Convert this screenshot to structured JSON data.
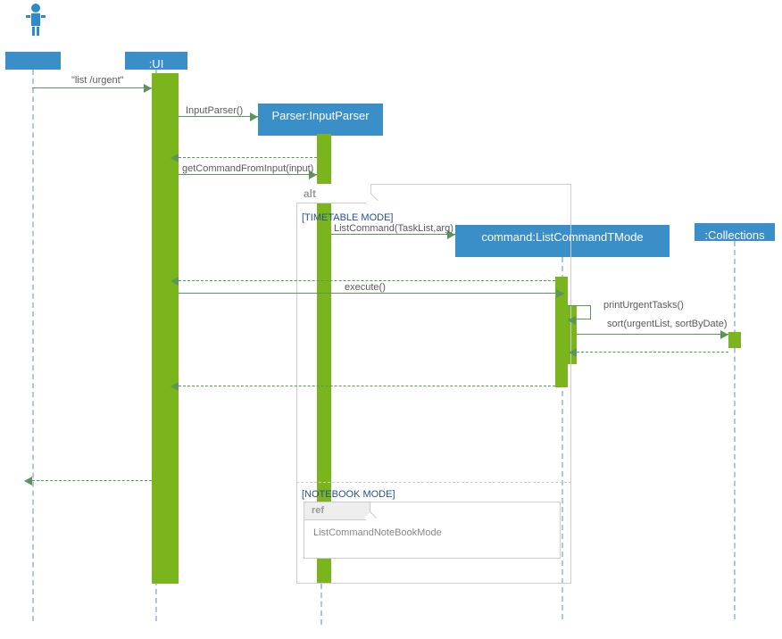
{
  "actor": {
    "label": ""
  },
  "participants": {
    "ui": ":UI",
    "parser": "Parser:InputParser",
    "command": "command:ListCommandTMode",
    "collections": ":Collections"
  },
  "fragment": {
    "label": "alt",
    "guards": {
      "timetable": "[TIMETABLE MODE]",
      "notebook": "[NOTEBOOK MODE]"
    },
    "ref": {
      "label": "ref",
      "content": "ListCommandNoteBookMode"
    }
  },
  "messages": {
    "m1": "\"list /urgent\"",
    "m2": "InputParser()",
    "m3": "getCommandFromInput(input)",
    "m4": "ListCommand(TaskList,arg)",
    "m5": "execute()",
    "m6": "printUrgentTasks()",
    "m7": "sort(urgentList, sortByDate)"
  }
}
